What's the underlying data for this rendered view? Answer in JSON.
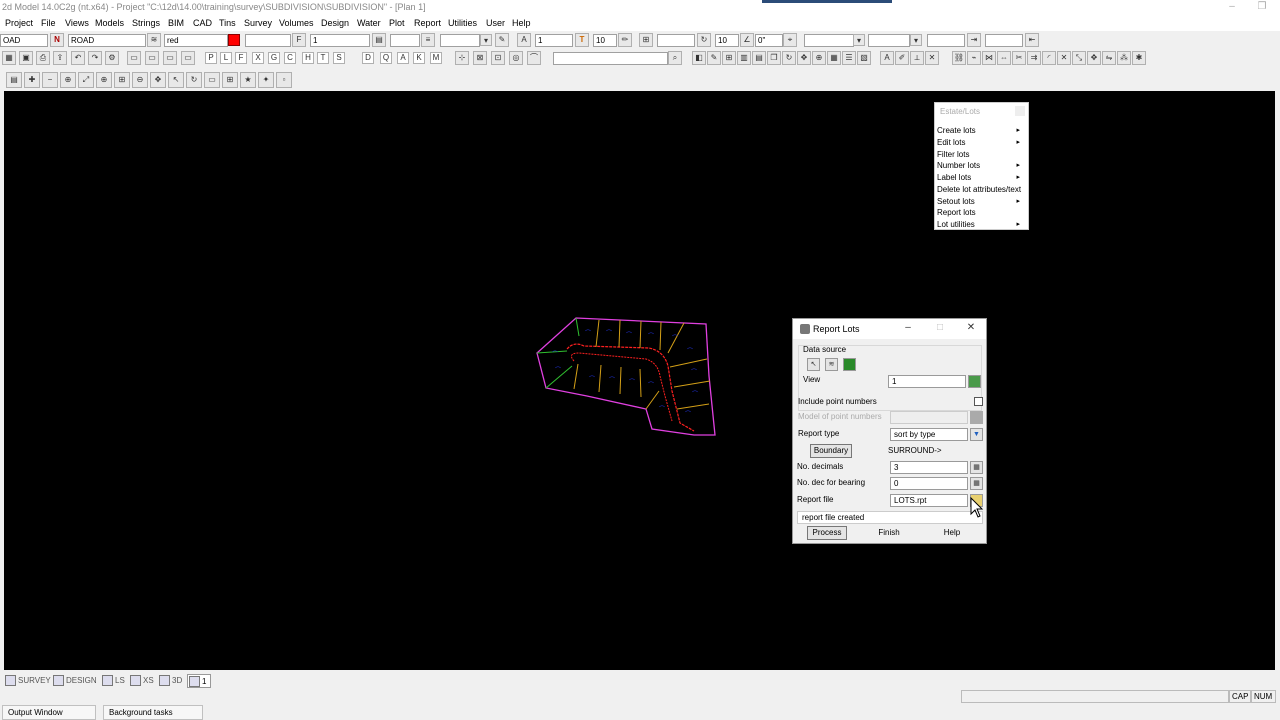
{
  "app": {
    "title": "2d Model  14.0C2g (nt.x64) - Project \"C:\\12d\\14.00\\training\\survey\\SUBDIVISION\\SUBDIVISION\" - [Plan 1]"
  },
  "menu": [
    "Project",
    "File",
    "Views",
    "Models",
    "Strings",
    "BIM",
    "CAD",
    "Tins",
    "Survey",
    "Volumes",
    "Design",
    "Water",
    "Plot",
    "Report",
    "Utilities",
    "User",
    "Help"
  ],
  "toolbar1": {
    "model_left": "OAD",
    "n_letter": "N",
    "model_name": "ROAD",
    "colour_name": "red",
    "colour_swatch": "#ff0000",
    "weight_value": "1",
    "text_size": "1",
    "t_letter": "T",
    "size_value": "10",
    "angle_size": "10",
    "angle_value": "0\""
  },
  "toolbar2": {
    "letters": [
      "P",
      "L",
      "F",
      "X",
      "G",
      "C",
      "H",
      "T",
      "S",
      "D",
      "Q",
      "A",
      "K",
      "M"
    ]
  },
  "estate_menu": {
    "title": "Estate/Lots",
    "items": [
      {
        "label": "Create lots",
        "arrow": "▸"
      },
      {
        "label": "Edit lots",
        "arrow": "▸"
      },
      {
        "label": "Filter lots",
        "arrow": ""
      },
      {
        "label": "Number lots",
        "arrow": "▸"
      },
      {
        "label": "Label lots",
        "arrow": "▸"
      },
      {
        "label": "Delete lot attributes/text",
        "arrow": ""
      },
      {
        "label": "Setout lots",
        "arrow": "▸"
      },
      {
        "label": "Report lots",
        "arrow": ""
      },
      {
        "label": "Lot utilities",
        "arrow": "▸"
      }
    ]
  },
  "dialog": {
    "title": "Report Lots",
    "data_source_label": "Data source",
    "view_label": "View",
    "view_value": "1",
    "include_point_numbers_label": "Include point numbers",
    "include_point_numbers_checked": false,
    "model_point_numbers_label": "Model of point numbers",
    "report_type_label": "Report type",
    "report_type_value": "sort by type",
    "boundary_button": "Boundary",
    "boundary_value": "SURROUND->",
    "decimals_label": "No. decimals",
    "decimals_value": "3",
    "bearing_label": "No. dec for bearing",
    "bearing_value": "0",
    "report_file_label": "Report file",
    "report_file_value": "LOTS.rpt",
    "message": "report file created",
    "process_button": "Process",
    "finish_button": "Finish",
    "help_button": "Help"
  },
  "bottom_tabs": [
    "SURVEY",
    "DESIGN",
    "LS",
    "XS",
    "3D",
    "1"
  ],
  "status": {
    "cap": "CAP",
    "num": "NUM"
  },
  "output_tabs": [
    "Output Window",
    "Background tasks"
  ],
  "colors": {
    "canvas": "#000000",
    "lot_boundary": "#e040e0",
    "lot_lines": "#d4a017",
    "road_string": "#ff2020",
    "lot_labels": "#2030d0"
  }
}
